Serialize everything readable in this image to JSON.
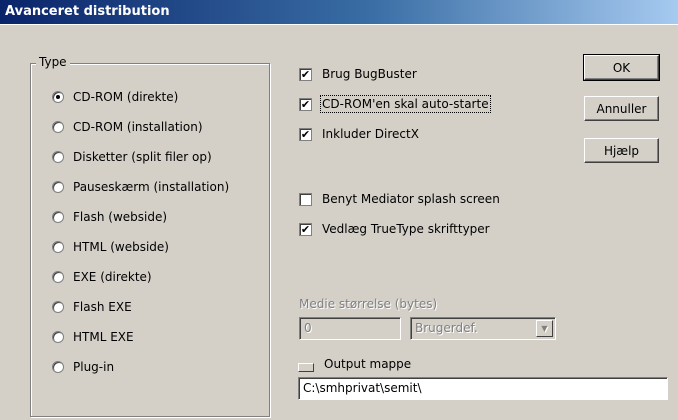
{
  "window": {
    "title": "Avanceret distribution"
  },
  "type_group": {
    "label": "Type",
    "options": [
      {
        "label": "CD-ROM (direkte)",
        "checked": true
      },
      {
        "label": "CD-ROM (installation)",
        "checked": false
      },
      {
        "label": "Disketter (split filer op)",
        "checked": false
      },
      {
        "label": "Pauseskærm (installation)",
        "checked": false
      },
      {
        "label": "Flash (webside)",
        "checked": false
      },
      {
        "label": "HTML (webside)",
        "checked": false
      },
      {
        "label": "EXE (direkte)",
        "checked": false
      },
      {
        "label": "Flash EXE",
        "checked": false
      },
      {
        "label": "HTML EXE",
        "checked": false
      },
      {
        "label": "Plug-in",
        "checked": false
      }
    ]
  },
  "options": {
    "bugbuster": {
      "label": "Brug BugBuster",
      "checked": true
    },
    "autostart": {
      "label": "CD-ROM'en skal auto-starte",
      "checked": true
    },
    "directx": {
      "label": "Inkluder DirectX",
      "checked": true
    },
    "mediator_splash": {
      "label": "Benyt Mediator splash screen",
      "checked": false
    },
    "truetype": {
      "label": "Vedlæg TrueType skrifttyper",
      "checked": true
    }
  },
  "buttons": {
    "ok": "OK",
    "cancel": "Annuller",
    "help": "Hjælp"
  },
  "media": {
    "label": "Medie størrelse (bytes)",
    "size_value": "0",
    "size_select": "Brugerdef."
  },
  "output": {
    "label": "Output mappe",
    "path": "C:\\smhprivat\\semit\\"
  },
  "check_glyph": "✔",
  "dropdown_glyph": "▼"
}
